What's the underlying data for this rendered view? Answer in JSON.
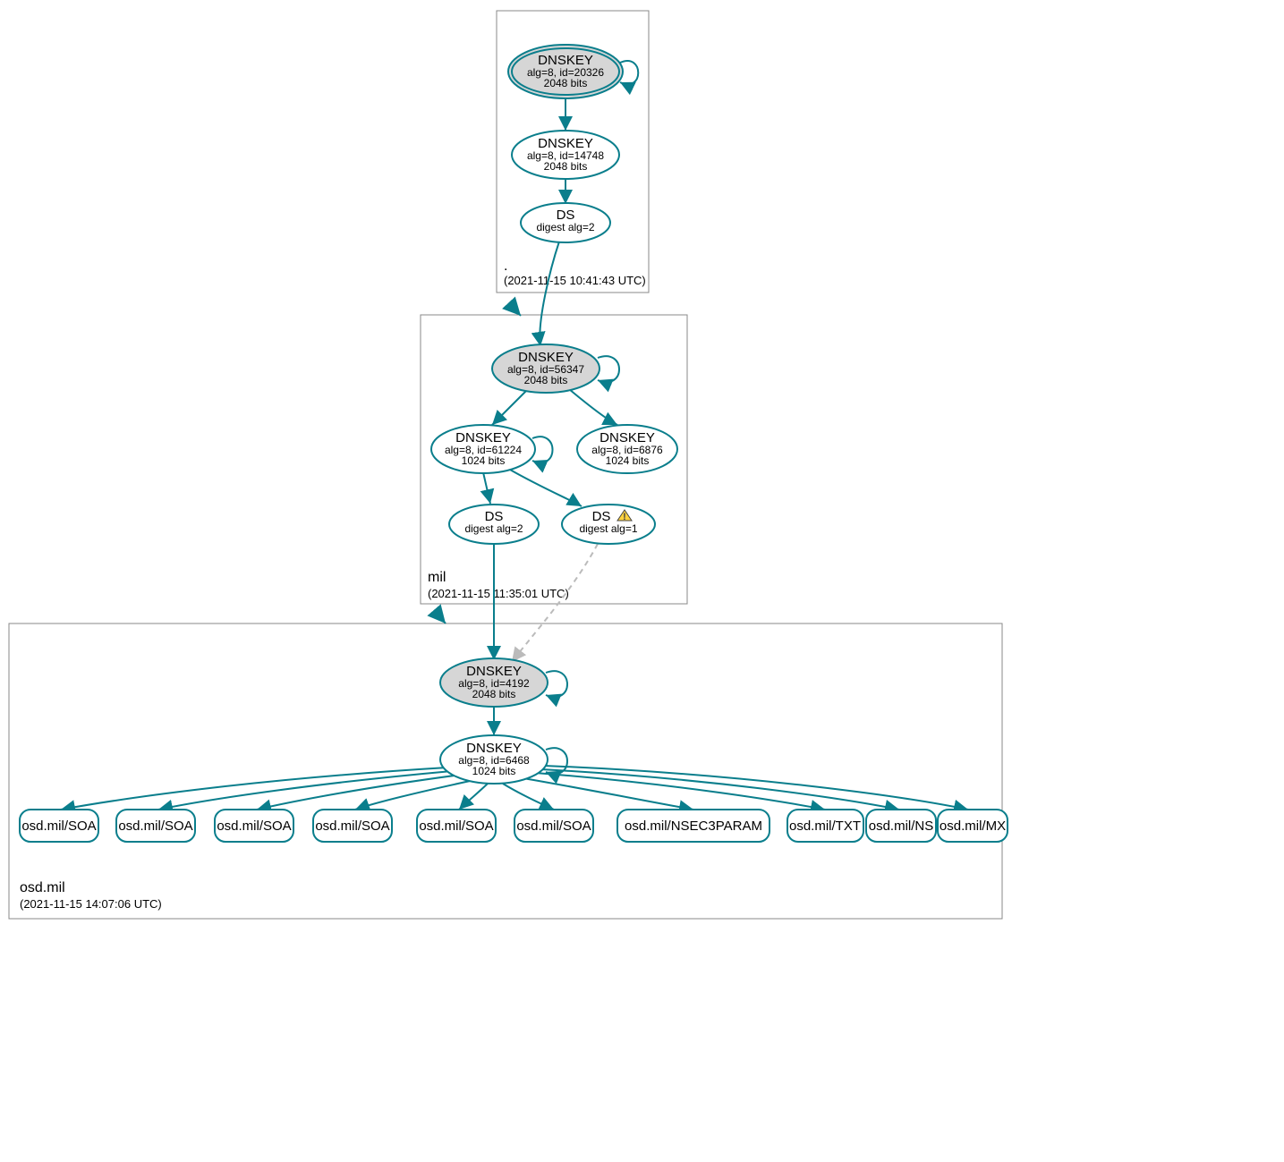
{
  "zones": {
    "root": {
      "name": ".",
      "timestamp": "(2021-11-15 10:41:43 UTC)"
    },
    "mil": {
      "name": "mil",
      "timestamp": "(2021-11-15 11:35:01 UTC)"
    },
    "osd": {
      "name": "osd.mil",
      "timestamp": "(2021-11-15 14:07:06 UTC)"
    }
  },
  "nodes": {
    "root_ksk": {
      "title": "DNSKEY",
      "line2": "alg=8, id=20326",
      "line3": "2048 bits"
    },
    "root_zsk": {
      "title": "DNSKEY",
      "line2": "alg=8, id=14748",
      "line3": "2048 bits"
    },
    "root_ds": {
      "title": "DS",
      "line2": "digest alg=2"
    },
    "mil_ksk": {
      "title": "DNSKEY",
      "line2": "alg=8, id=56347",
      "line3": "2048 bits"
    },
    "mil_zsk_a": {
      "title": "DNSKEY",
      "line2": "alg=8, id=61224",
      "line3": "1024 bits"
    },
    "mil_zsk_b": {
      "title": "DNSKEY",
      "line2": "alg=8, id=6876",
      "line3": "1024 bits"
    },
    "mil_ds_2": {
      "title": "DS",
      "line2": "digest alg=2"
    },
    "mil_ds_1": {
      "title": "DS",
      "line2": "digest alg=1"
    },
    "osd_ksk": {
      "title": "DNSKEY",
      "line2": "alg=8, id=4192",
      "line3": "2048 bits"
    },
    "osd_zsk": {
      "title": "DNSKEY",
      "line2": "alg=8, id=6468",
      "line3": "1024 bits"
    }
  },
  "rrsets": {
    "r0": "osd.mil/SOA",
    "r1": "osd.mil/SOA",
    "r2": "osd.mil/SOA",
    "r3": "osd.mil/SOA",
    "r4": "osd.mil/SOA",
    "r5": "osd.mil/SOA",
    "r6": "osd.mil/NSEC3PARAM",
    "r7": "osd.mil/TXT",
    "r8": "osd.mil/NS",
    "r9": "osd.mil/MX"
  }
}
